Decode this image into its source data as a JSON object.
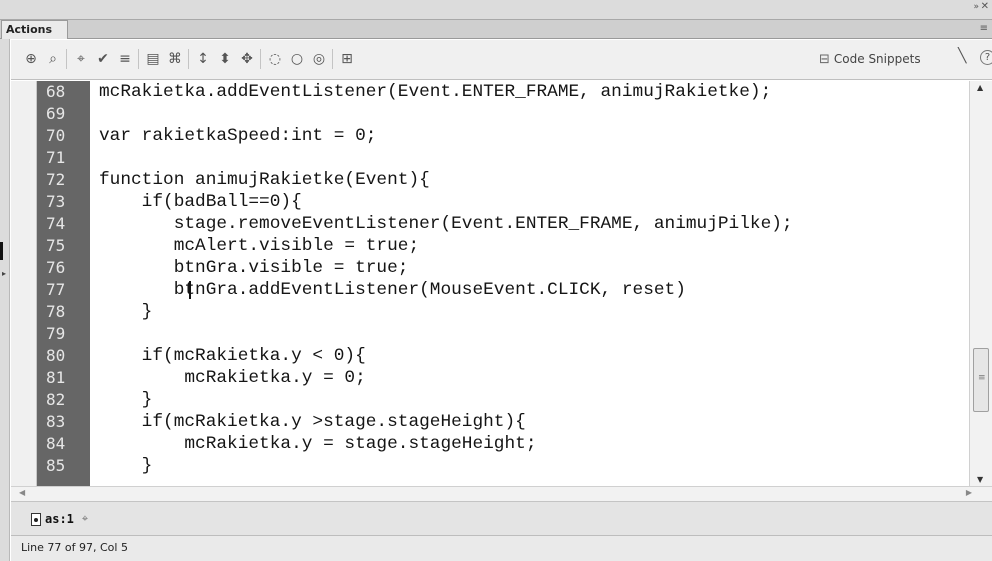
{
  "panel": {
    "tab_title": "Actions"
  },
  "window": {
    "collapse_icon": "double-chevron-right-icon",
    "close_icon": "close-icon",
    "menu_icon": "panel-menu-icon"
  },
  "toolbar": {
    "icons": [
      "add-statement-icon",
      "find-icon",
      "insert-target-path-icon",
      "check-syntax-icon",
      "auto-format-icon",
      "show-code-hint-icon",
      "debug-options-icon",
      "collapse-between-braces-icon",
      "collapse-selection-icon",
      "expand-all-icon",
      "apply-block-comment-icon",
      "apply-line-comment-icon",
      "remove-comment-icon",
      "show-hide-toolbox-icon"
    ],
    "code_snippets_label": "Code Snippets",
    "wand_icon": "magic-wand-icon",
    "help_icon": "help-icon"
  },
  "editor": {
    "lines": [
      {
        "num": "68",
        "code": "mcRakietka.addEventListener(Event.ENTER_FRAME, animujRakietke);"
      },
      {
        "num": "69",
        "code": ""
      },
      {
        "num": "70",
        "code": "var rakietkaSpeed:int = 0;"
      },
      {
        "num": "71",
        "code": ""
      },
      {
        "num": "72",
        "code": "function animujRakietke(Event){"
      },
      {
        "num": "73",
        "code": "    if(badBall==0){"
      },
      {
        "num": "74",
        "code": "       stage.removeEventListener(Event.ENTER_FRAME, animujPilke);"
      },
      {
        "num": "75",
        "code": "       mcAlert.visible = true;"
      },
      {
        "num": "76",
        "code": "       btnGra.visible = true;"
      },
      {
        "num": "77",
        "code": "       btnGra.addEventListener(MouseEvent.CLICK, reset)"
      },
      {
        "num": "78",
        "code": "    }"
      },
      {
        "num": "79",
        "code": ""
      },
      {
        "num": "80",
        "code": "    if(mcRakietka.y < 0){"
      },
      {
        "num": "81",
        "code": "        mcRakietka.y = 0;"
      },
      {
        "num": "82",
        "code": "    }"
      },
      {
        "num": "83",
        "code": "    if(mcRakietka.y >stage.stageHeight){"
      },
      {
        "num": "84",
        "code": "        mcRakietka.y = stage.stageHeight;"
      },
      {
        "num": "85",
        "code": "    }"
      }
    ]
  },
  "script_tab": {
    "label": "as:1"
  },
  "status": {
    "text": "Line 77 of 97, Col 5"
  }
}
